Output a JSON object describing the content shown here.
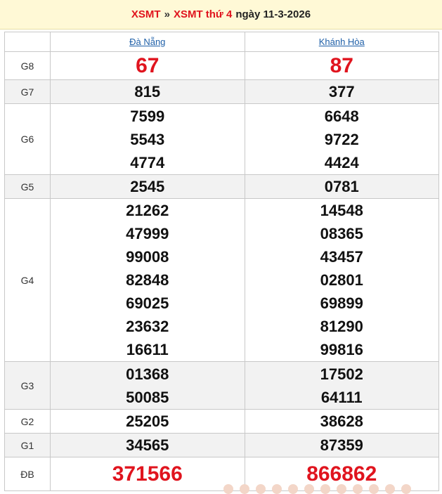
{
  "header": {
    "crumb1": "XSMT",
    "separator": "»",
    "crumb2": "XSMT thứ 4",
    "date_text": "ngày 11-3-2026"
  },
  "provinces": [
    "Đà Nẵng",
    "Khánh Hòa"
  ],
  "prizes": [
    {
      "label": "G8",
      "col1": [
        "67"
      ],
      "col2": [
        "87"
      ]
    },
    {
      "label": "G7",
      "col1": [
        "815"
      ],
      "col2": [
        "377"
      ]
    },
    {
      "label": "G6",
      "col1": [
        "7599",
        "5543",
        "4774"
      ],
      "col2": [
        "6648",
        "9722",
        "4424"
      ]
    },
    {
      "label": "G5",
      "col1": [
        "2545"
      ],
      "col2": [
        "0781"
      ]
    },
    {
      "label": "G4",
      "col1": [
        "21262",
        "47999",
        "99008",
        "82848",
        "69025",
        "23632",
        "16611"
      ],
      "col2": [
        "14548",
        "08365",
        "43457",
        "02801",
        "69899",
        "81290",
        "99816"
      ]
    },
    {
      "label": "G3",
      "col1": [
        "01368",
        "50085"
      ],
      "col2": [
        "17502",
        "64111"
      ]
    },
    {
      "label": "G2",
      "col1": [
        "25205"
      ],
      "col2": [
        "38628"
      ]
    },
    {
      "label": "G1",
      "col1": [
        "34565"
      ],
      "col2": [
        "87359"
      ]
    },
    {
      "label": "ĐB",
      "col1": [
        "371566"
      ],
      "col2": [
        "866862"
      ]
    }
  ],
  "colors": {
    "accent": "#e0141e",
    "link": "#1e5fa8",
    "header_bg": "#fff9d6",
    "alt_row": "#f2f2f2"
  }
}
